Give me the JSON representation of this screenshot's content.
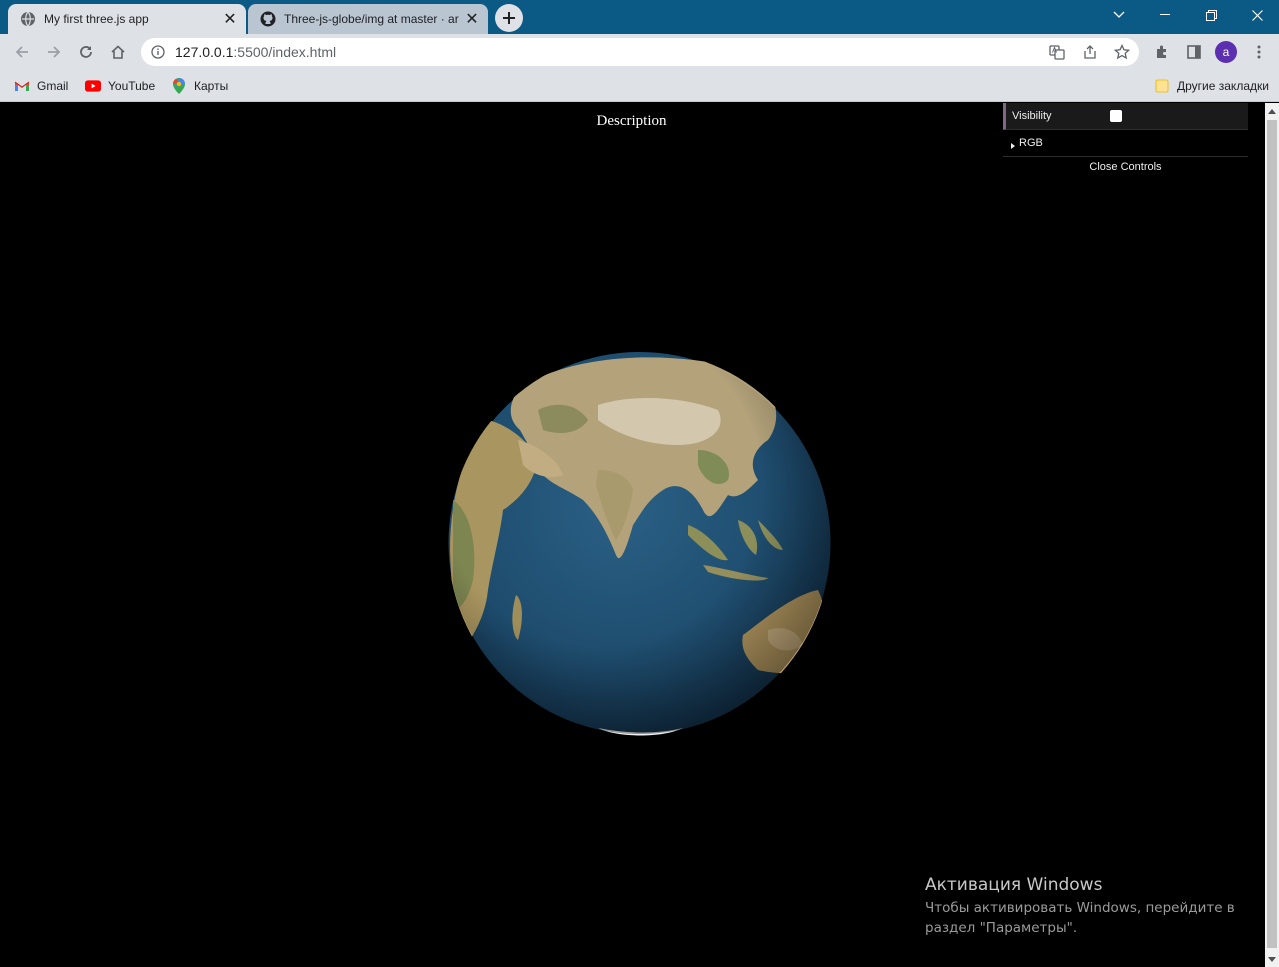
{
  "browser": {
    "tabs": [
      {
        "title": "My first three.js app",
        "active": true,
        "icon": "globe-icon"
      },
      {
        "title": "Three-js-globe/img at master · ar",
        "active": false,
        "icon": "github-icon"
      }
    ],
    "address": {
      "host": "127.0.0.1",
      "path": ":5500/index.html"
    },
    "profile_initial": "a",
    "bookmarks": [
      {
        "label": "Gmail",
        "icon": "gmail-icon"
      },
      {
        "label": "YouTube",
        "icon": "youtube-icon"
      },
      {
        "label": "Карты",
        "icon": "maps-icon"
      }
    ],
    "other_bookmarks": "Другие закладки",
    "colors": {
      "tab_strip": "#0b5a86",
      "toolbar": "#dee1e6",
      "avatar": "#5b2fb0"
    }
  },
  "page": {
    "description": "Description",
    "gui": {
      "visibility_label": "Visibility",
      "visibility_checked": false,
      "folder_label": "RGB",
      "close_label": "Close Controls"
    }
  },
  "watermark": {
    "title": "Активация Windows",
    "text": "Чтобы активировать Windows, перейдите в раздел \"Параметры\"."
  }
}
